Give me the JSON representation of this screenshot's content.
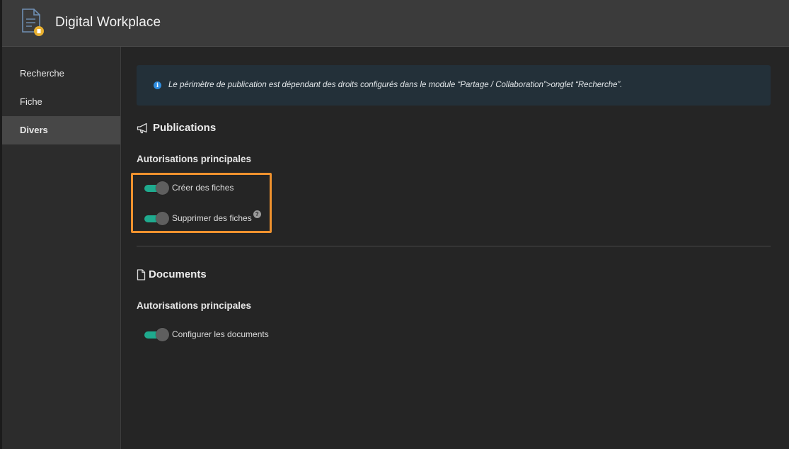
{
  "header": {
    "title": "Digital Workplace",
    "icon": "document-badge-icon"
  },
  "sidebar": {
    "items": [
      {
        "label": "Recherche",
        "active": false
      },
      {
        "label": "Fiche",
        "active": false
      },
      {
        "label": "Divers",
        "active": true
      }
    ]
  },
  "main": {
    "info": {
      "icon": "info-icon",
      "text": "Le périmètre de publication est dépendant des droits configurés dans le module “Partage / Collaboration”>onglet “Recherche”."
    },
    "publications": {
      "title": "Publications",
      "icon": "megaphone-icon",
      "subtitle": "Autorisations principales",
      "toggles": [
        {
          "label": "Créer des fiches",
          "on": true
        },
        {
          "label": "Supprimer des fiches",
          "on": true,
          "help": "?"
        }
      ]
    },
    "documents": {
      "title": "Documents",
      "icon": "file-icon",
      "subtitle": "Autorisations principales",
      "toggles": [
        {
          "label": "Configurer les documents",
          "on": true
        }
      ]
    }
  },
  "colors": {
    "accent_toggle": "#1faa8e",
    "highlight": "#f0922e",
    "info_bg": "#233039",
    "info_icon": "#2f8ddf"
  }
}
